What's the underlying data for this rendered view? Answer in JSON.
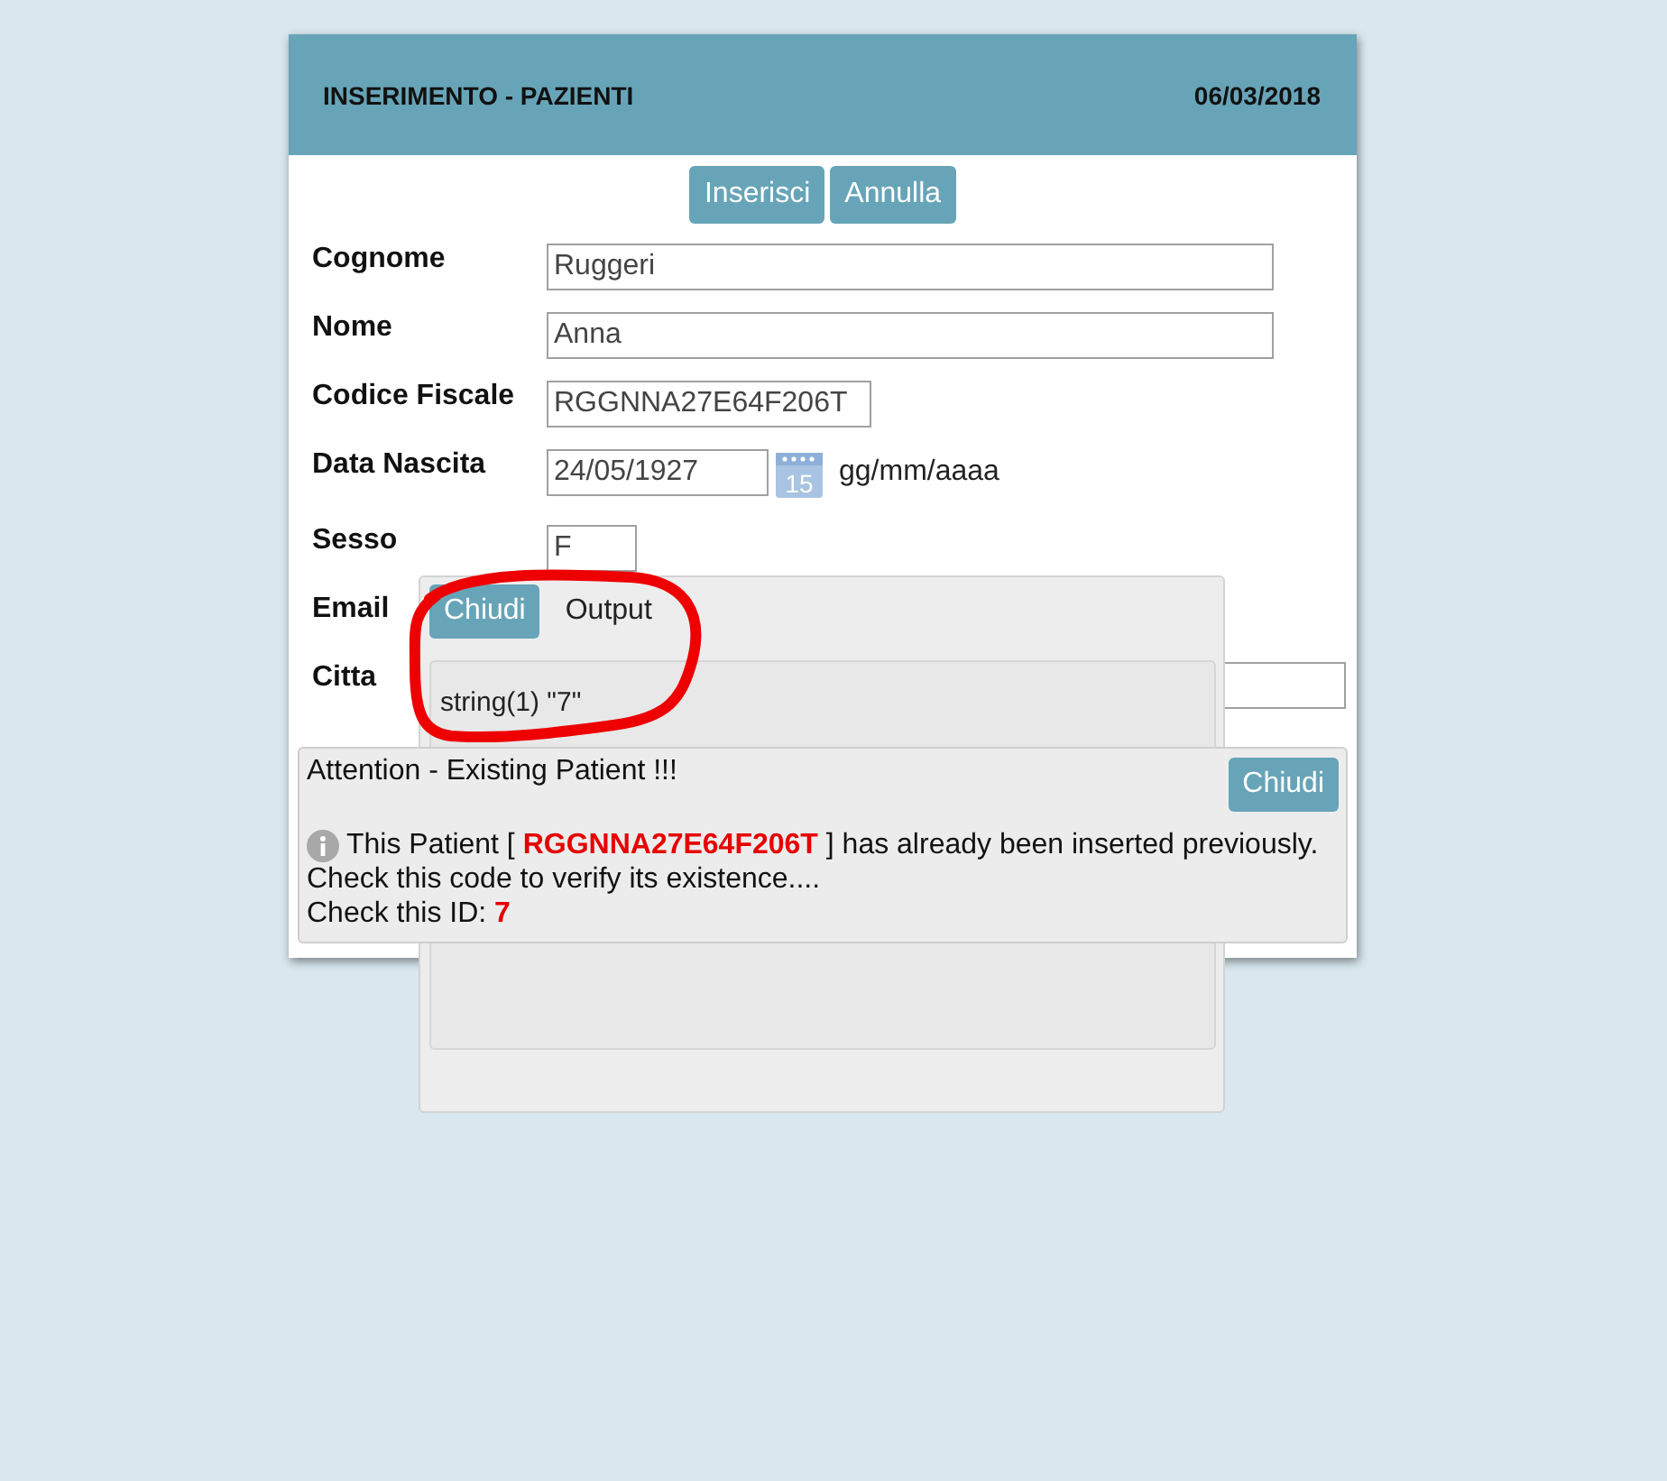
{
  "header": {
    "title": "INSERIMENTO - PAZIENTI",
    "date": "06/03/2018"
  },
  "actions": [
    "Inserisci",
    "Annulla"
  ],
  "fields": [
    {
      "label": "Cognome",
      "kind": "text",
      "value": "Ruggeri"
    },
    {
      "label": "Nome",
      "kind": "text",
      "value": "Anna"
    },
    {
      "label": "Codice Fiscale",
      "kind": "code",
      "value": "RGGNNA27E64F206T"
    },
    {
      "label": "Data Nascita",
      "kind": "date",
      "value": "24/05/1927",
      "calendar_day": "15",
      "hint": "gg/mm/aaaa"
    },
    {
      "label": "Sesso",
      "kind": "select",
      "value": "F"
    },
    {
      "label": "Email",
      "kind": "covered"
    },
    {
      "label": "Citta",
      "kind": "long"
    }
  ],
  "output_popup": {
    "close_button": "Chiudi",
    "title": "Output",
    "content": "string(1) \"7\""
  },
  "alert": {
    "title": "Attention - Existing Patient !!!",
    "close_button": "Chiudi",
    "lines": [
      "This Patient [ **RGGNNA27E64F206T** ] has already been inserted previously.",
      "Check this code to verify its existence....",
      "Check this ID: **7**"
    ]
  }
}
